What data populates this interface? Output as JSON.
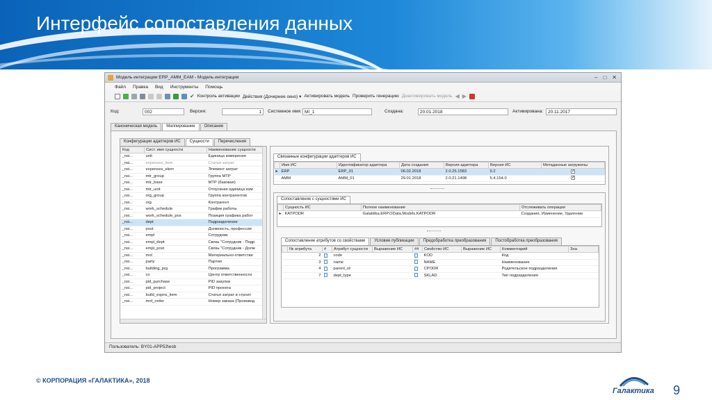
{
  "slide": {
    "title": "Интерфейс сопоставления данных",
    "footer": "© КОРПОРАЦИЯ «ГАЛАКТИКА», 2018",
    "page_number": "9",
    "logo_text": "Галактика",
    "logo_small": "корпорация"
  },
  "window": {
    "title": "Модель интеграции ERP_AMM_EAM - Модель интеграции",
    "min": "–",
    "max": "□",
    "close": "✕",
    "menu": [
      "Файл",
      "Правка",
      "Вид",
      "Инструменты",
      "Помощь"
    ],
    "toolbar": {
      "control": "Контроль активации",
      "actions": "Действия (Дочернее окно) ▾",
      "activate": "Активировать модель",
      "check": "Проверить генерацию",
      "deactivate": "Деактивировать модель"
    },
    "fields": {
      "code_label": "Код:",
      "code_value": "002",
      "version_label": "Версия:",
      "version_value": "1",
      "sysname_label": "Системное имя:",
      "sysname_value": "MI_1",
      "created_label": "Создана:",
      "created_value": "20.01.2018",
      "activated_label": "Активирована:",
      "activated_value": "20.11.2017"
    },
    "main_tabs": [
      "Каноническая модель",
      "Маппирование",
      "Описание"
    ],
    "sub_tabs": [
      "Конфигурации адаптеров ИС",
      "Сущности",
      "Перечисления"
    ],
    "entities": {
      "headers": [
        "Код",
        "Сист. имя сущности",
        "Наименование сущности"
      ],
      "rows": [
        {
          "code": "_nsi...",
          "sys": "unit",
          "name": "Единица измерения",
          "grey": false
        },
        {
          "code": "_nsi...",
          "sys": "expenses_item",
          "name": "Статья затрат",
          "grey": true
        },
        {
          "code": "_nsi...",
          "sys": "expenses_elem",
          "name": "Элемент затрат",
          "grey": false
        },
        {
          "code": "_nsi...",
          "sys": "mtr_group",
          "name": "Группа МТР",
          "grey": false
        },
        {
          "code": "_nsi...",
          "sys": "mtr_base",
          "name": "МТР (базовая)",
          "grey": false
        },
        {
          "code": "_nsi...",
          "sys": "mtr_unit",
          "name": "Отпускная единица изм",
          "grey": false
        },
        {
          "code": "_nsi...",
          "sys": "org_group",
          "name": "Группа контрагентов",
          "grey": false
        },
        {
          "code": "_nsi...",
          "sys": "org",
          "name": "Контрагент",
          "grey": false
        },
        {
          "code": "_nsi...",
          "sys": "work_schedule",
          "name": "График работы",
          "grey": false
        },
        {
          "code": "_nsi...",
          "sys": "work_schedule_pos",
          "name": "Позиция графика работ",
          "grey": false
        },
        {
          "code": "_nsi...",
          "sys": "dept",
          "name": "Подразделение",
          "grey": false
        },
        {
          "code": "_nsi...",
          "sys": "post",
          "name": "Должность, профессия",
          "grey": false
        },
        {
          "code": "_nsi...",
          "sys": "empl",
          "name": "Сотрудник",
          "grey": false
        },
        {
          "code": "_nsi...",
          "sys": "empl_dept",
          "name": "Связь \"Сотрудник - Подр",
          "grey": false
        },
        {
          "code": "_nsi...",
          "sys": "empl_post",
          "name": "Связь \"Сотрудник - Долж",
          "grey": false
        },
        {
          "code": "_nsi...",
          "sys": "mol",
          "name": "Материально-ответстве",
          "grey": false
        },
        {
          "code": "_nsi...",
          "sys": "party",
          "name": "Партия",
          "grey": false
        },
        {
          "code": "_nsi...",
          "sys": "building_prg",
          "name": "Программа",
          "grey": false
        },
        {
          "code": "_nsi...",
          "sys": "co",
          "name": "Центр ответственности",
          "grey": false
        },
        {
          "code": "_nsi...",
          "sys": "pid_purchase",
          "name": "PID закупки",
          "grey": false
        },
        {
          "code": "_nsi...",
          "sys": "pid_project",
          "name": "PID проекта",
          "grey": false
        },
        {
          "code": "_nsi...",
          "sys": "build_expns_item",
          "name": "Статья затрат в строит",
          "grey": false
        },
        {
          "code": "_nsi...",
          "sys": "mnf_order",
          "name": "Номер заказа (Производ",
          "grey": false
        }
      ]
    },
    "adapters": {
      "tab": "Связанные конфигурации адаптеров ИС",
      "headers": [
        "Имя ИС",
        "Идентификатор адаптера",
        "Дата создания",
        "Версия адаптера",
        "Версия ИС",
        "Метаданные загружены"
      ],
      "rows": [
        {
          "is": "ERP",
          "id": "ERP_01",
          "date": "06.02.2018",
          "ver": "2.0.25.1583",
          "isver": "9.2",
          "loaded": true
        },
        {
          "is": "AMM",
          "id": "AMM_01",
          "date": "29.01.2018",
          "ver": "2.0.21.1498",
          "isver": "5.4.154.0",
          "loaded": true
        }
      ]
    },
    "is_entities": {
      "tab": "Сопоставление с сущностями ИС",
      "headers": [
        "Сущность ИС",
        "Полное наименование",
        "Отслеживать операции"
      ],
      "rows": [
        {
          "entity": "KATPODR",
          "full": "Galaktika.ERP.OData.Models.KATPODR",
          "ops": "Создание, Изменение, Удаление"
        }
      ]
    },
    "attr_tabs": [
      "Сопоставление атрибутов со свойствами",
      "Условие публикации",
      "Предобработка преобразования",
      "Постобработка преобразования"
    ],
    "attributes": {
      "headers": [
        "№ атрибута",
        "#",
        "Атрибут сущности",
        "Выражение ИС",
        "##",
        "Свойство ИС",
        "Выражение ИС",
        "Комментарий",
        "Зна"
      ],
      "rows": [
        {
          "num": "2",
          "attr": "code",
          "prop": "KOD",
          "comment": "Код"
        },
        {
          "num": "3",
          "attr": "name",
          "prop": "NAME",
          "comment": "Наименование"
        },
        {
          "num": "4",
          "attr": "parent_id",
          "prop": "CPODR",
          "comment": "Родительское подразделение"
        },
        {
          "num": "7",
          "attr": "dept_type",
          "prop": "SKLAD",
          "comment": "Тип подразделения"
        }
      ]
    },
    "status": "Пользователь: BY01-APP53\\esb"
  },
  "colors": {
    "accent": "#0a63b8",
    "selection": "#cde4f7"
  }
}
